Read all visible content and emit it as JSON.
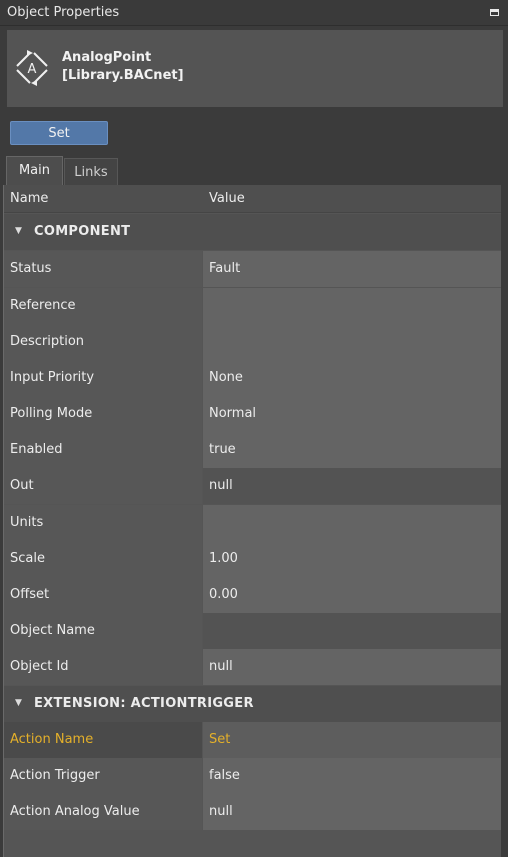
{
  "panel": {
    "title": "Object Properties"
  },
  "object": {
    "name_line1": "AnalogPoint",
    "name_line2": "[Library.BACnet]",
    "icon_letter": "A"
  },
  "actions": {
    "set_label": "Set"
  },
  "tabs": [
    {
      "label": "Main"
    },
    {
      "label": "Links"
    }
  ],
  "columns": {
    "name": "Name",
    "value": "Value"
  },
  "groups": [
    {
      "title": "COMPONENT"
    },
    {
      "title": "EXTENSION: ACTIONTRIGGER"
    }
  ],
  "component_rows": [
    {
      "name": "Status",
      "value": "Fault"
    },
    {
      "name": "Reference",
      "value": ""
    },
    {
      "name": "Description",
      "value": ""
    },
    {
      "name": "Input Priority",
      "value": "None"
    },
    {
      "name": "Polling Mode",
      "value": "Normal"
    },
    {
      "name": "Enabled",
      "value": "true"
    },
    {
      "name": "Out",
      "value": "null"
    },
    {
      "name": "Units",
      "value": ""
    },
    {
      "name": "Scale",
      "value": "1.00"
    },
    {
      "name": "Offset",
      "value": "0.00"
    },
    {
      "name": "Object Name",
      "value": ""
    },
    {
      "name": "Object Id",
      "value": "null"
    }
  ],
  "extension_rows": [
    {
      "name": "Action Name",
      "value": "Set"
    },
    {
      "name": "Action Trigger",
      "value": "false"
    },
    {
      "name": "Action Analog Value",
      "value": "null"
    }
  ],
  "colors": {
    "background": "#3b3b3b",
    "accent": "#5378a8",
    "selected_text": "#e4b02a"
  },
  "icons": {
    "panel_restore": "restore-icon",
    "object": "analog-point-icon",
    "expand": "collapse-arrow-icon"
  }
}
